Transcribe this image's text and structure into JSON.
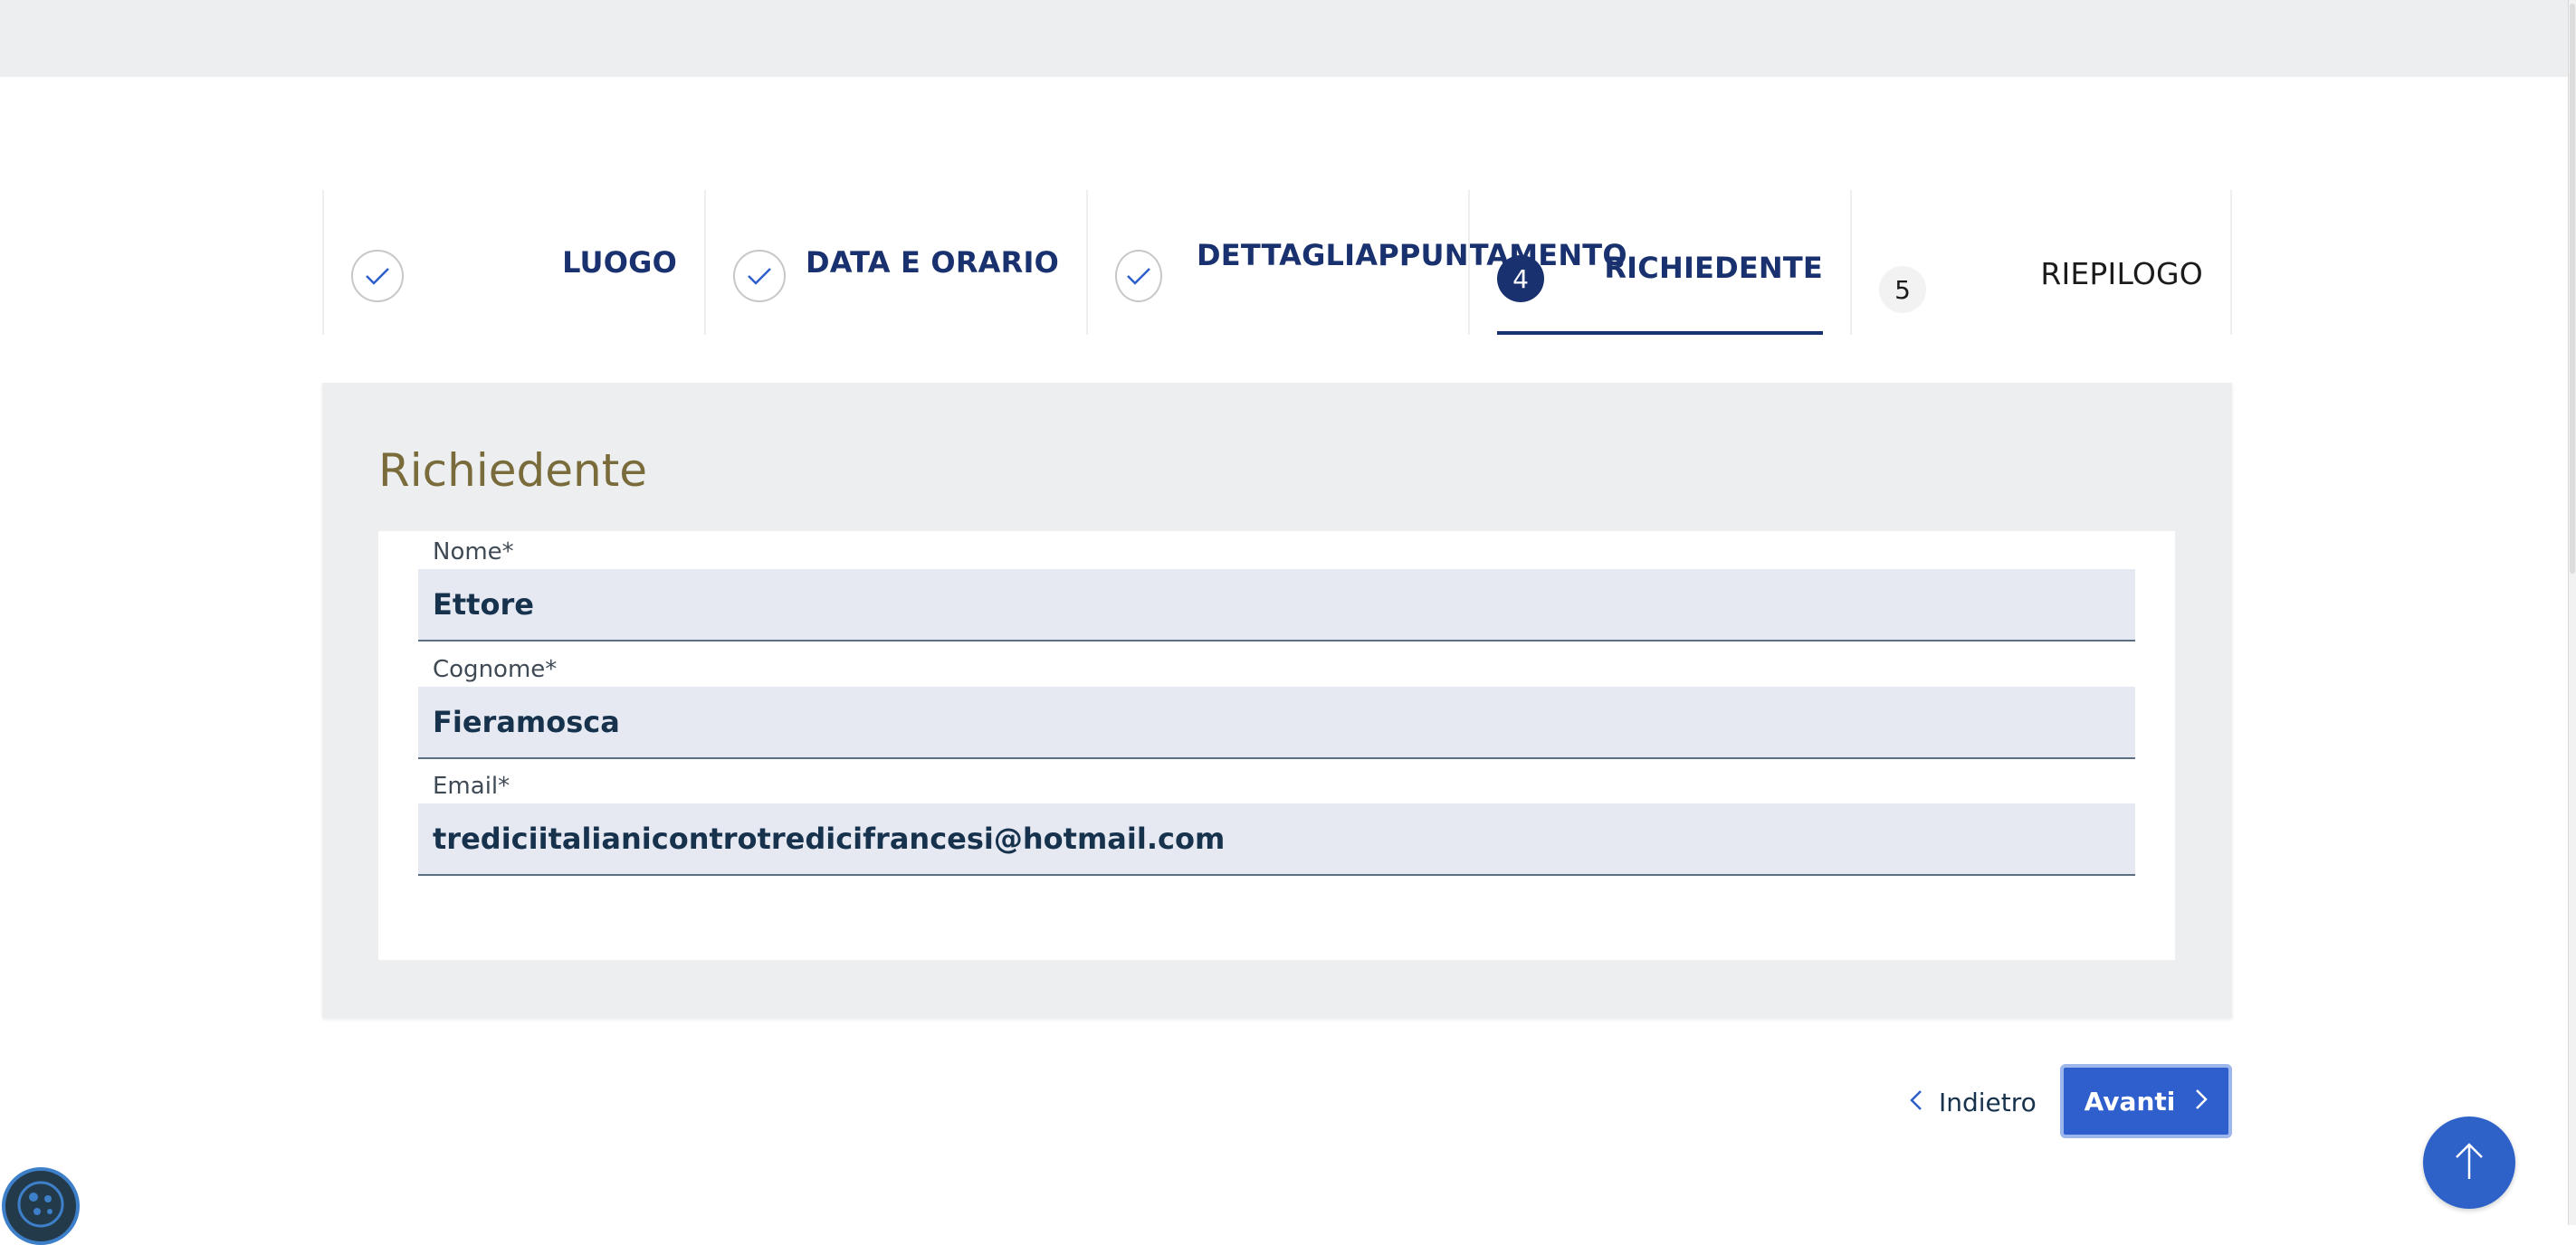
{
  "stepper": {
    "steps": [
      {
        "label": "LUOGO",
        "state": "done",
        "icon": "check-icon"
      },
      {
        "label": "DATA E ORARIO",
        "state": "done",
        "icon": "check-icon"
      },
      {
        "label_line1": "DETTAGLI",
        "label_line2": "APPUNTAMENTO",
        "state": "done",
        "icon": "check-icon"
      },
      {
        "number": "4",
        "label": "RICHIEDENTE",
        "state": "active"
      },
      {
        "number": "5",
        "label": "RIEPILOGO",
        "state": "todo"
      }
    ]
  },
  "form": {
    "title": "Richiedente",
    "fields": [
      {
        "label": "Nome*",
        "value": "Ettore"
      },
      {
        "label": "Cognome*",
        "value": "Fieramosca"
      },
      {
        "label": "Email*",
        "value": "trediciitalianicontrotredicifrancesi@hotmail.com"
      }
    ]
  },
  "actions": {
    "back_label": "Indietro",
    "next_label": "Avanti",
    "back_icon": "chevron-left-icon",
    "next_icon": "chevron-right-icon",
    "top_icon": "arrow-up-icon",
    "cookie_icon": "cookie-icon"
  },
  "colors": {
    "primary": "#19316e",
    "button": "#2e5fcc",
    "title": "#7a6b3b",
    "panel_bg": "#eceef0",
    "field_bg": "#e6e9f2"
  }
}
